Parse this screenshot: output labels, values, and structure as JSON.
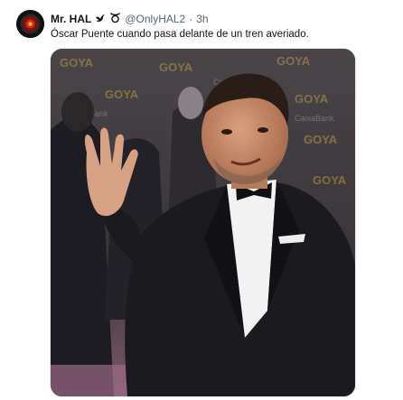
{
  "tweet": {
    "author_name": "Mr. HAL",
    "handle": "@OnlyHAL2",
    "separator": "·",
    "time": "3h",
    "text": "Óscar Puente cuando pasa delante de un tren averiado.",
    "avatar_icon": "hal-eye-icon",
    "badge_icons": [
      "bird-icon",
      "taurus-icon"
    ]
  },
  "media": {
    "image_icon": "man-waving-photo",
    "backdrop_text": [
      "GOYA",
      "CaixaBank"
    ]
  },
  "colors": {
    "text": "#0f1419",
    "muted": "#536471",
    "hal_red": "#d62a1e"
  }
}
